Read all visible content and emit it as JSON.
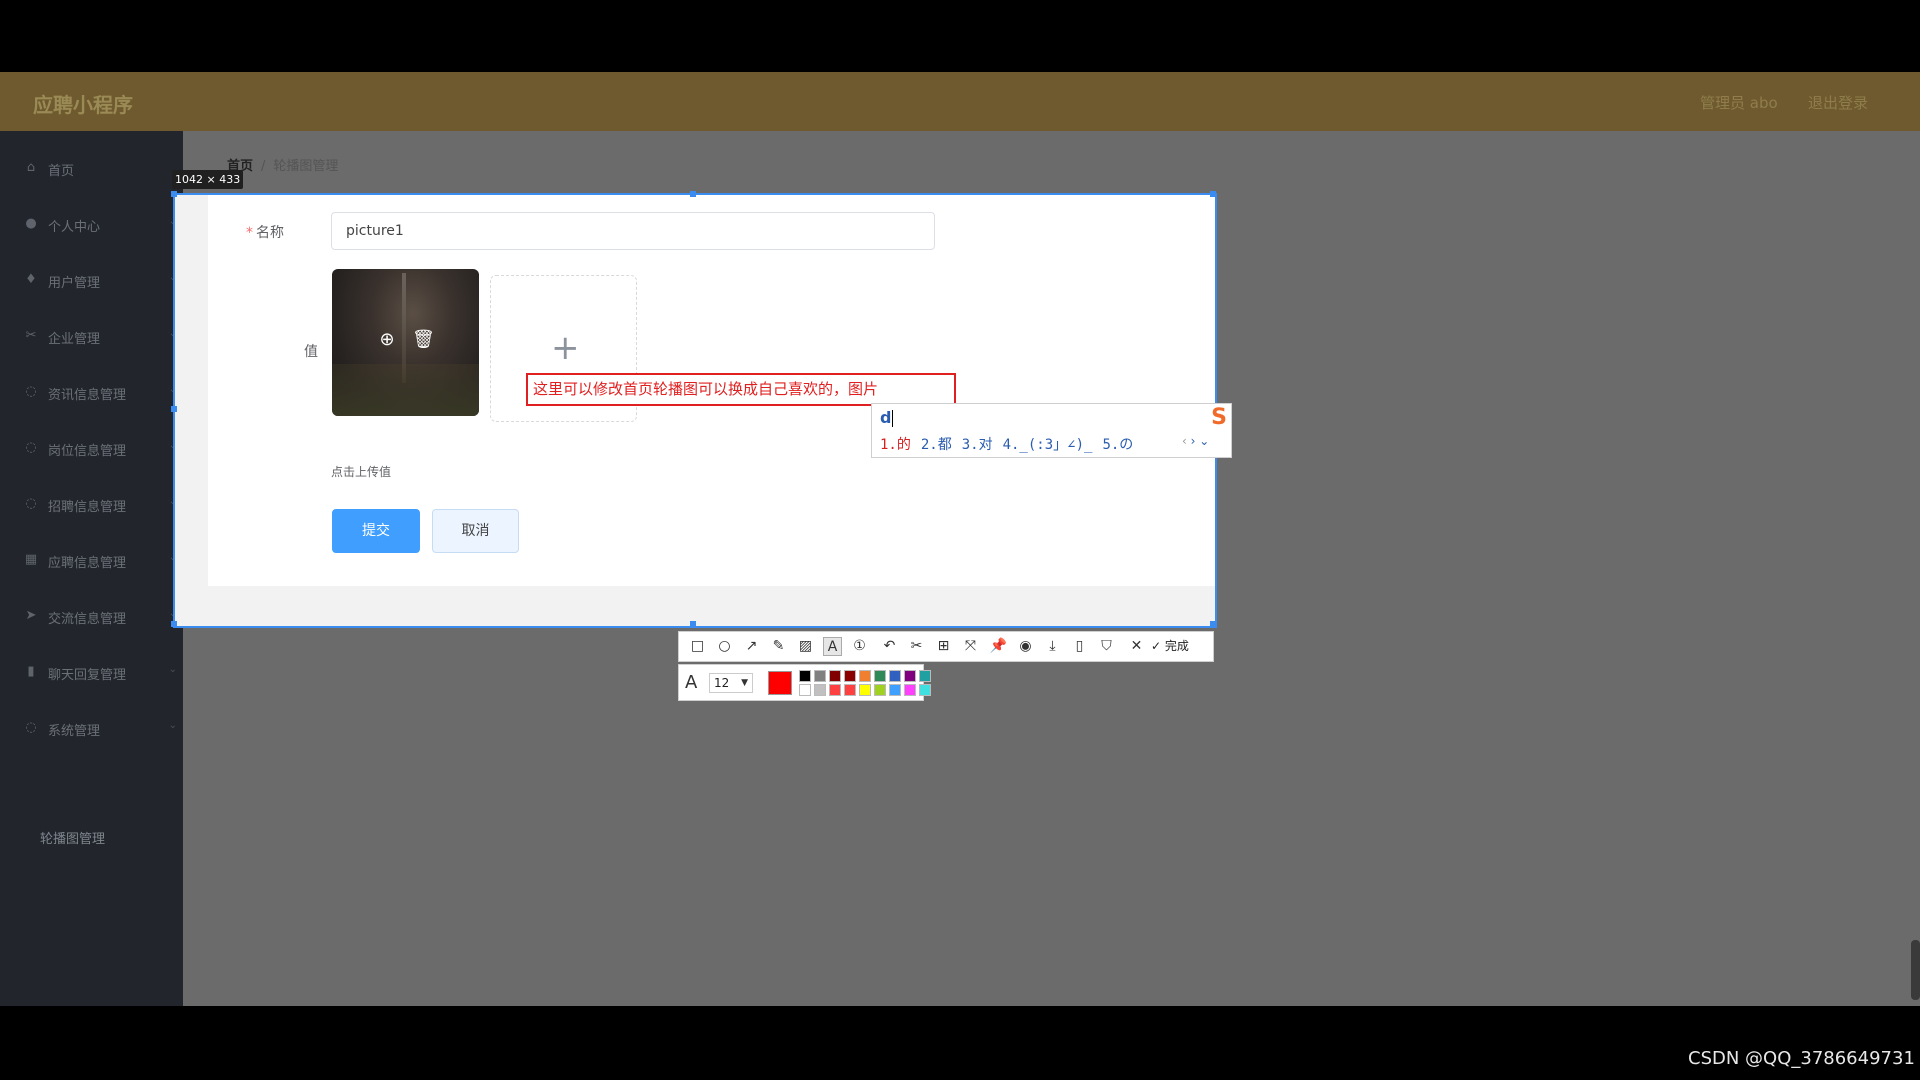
{
  "app": {
    "title": "应聘小程序",
    "admin_info": "管理员 abo",
    "logout": "退出登录"
  },
  "sidebar": {
    "items": [
      {
        "label": "首页",
        "icon": "home-icon",
        "glyph": "⌂"
      },
      {
        "label": "个人中心",
        "icon": "user-icon",
        "glyph": "●"
      },
      {
        "label": "用户管理",
        "icon": "mic-icon",
        "glyph": "♦"
      },
      {
        "label": "企业管理",
        "icon": "scissors-icon",
        "glyph": "✂"
      },
      {
        "label": "资讯信息管理",
        "icon": "circle-icon",
        "glyph": "◌"
      },
      {
        "label": "岗位信息管理",
        "icon": "circle-icon",
        "glyph": "◌"
      },
      {
        "label": "招聘信息管理",
        "icon": "circle-icon",
        "glyph": "◌"
      },
      {
        "label": "应聘信息管理",
        "icon": "bank-icon",
        "glyph": "▦"
      },
      {
        "label": "交流信息管理",
        "icon": "send-icon",
        "glyph": "➤"
      },
      {
        "label": "聊天回复管理",
        "icon": "chart-icon",
        "glyph": "▮"
      },
      {
        "label": "系统管理",
        "icon": "circle-icon",
        "glyph": "◌"
      }
    ],
    "sub_item": "轮播图管理"
  },
  "breadcrumb": {
    "home": "首页",
    "separator": "/",
    "current": "轮播图管理"
  },
  "selection": {
    "size_label": "1042 × 433",
    "border_color": "#3b8cf0"
  },
  "form": {
    "name_label": "名称",
    "name_value": "picture1",
    "value_label": "值",
    "upload_hint": "点击上传值",
    "submit_label": "提交",
    "cancel_label": "取消",
    "annotation_text": "这里可以修改首页轮播图可以换成自己喜欢的，图片",
    "annotation_color": "#e02020"
  },
  "ime": {
    "input": "d",
    "candidates": [
      "1.的",
      "2.都",
      "3.对",
      "4._(:3」∠)_",
      "5.の"
    ],
    "logo_glyph": "S"
  },
  "toolbar": {
    "tools": [
      {
        "name": "rectangle-tool-icon",
        "glyph": "□"
      },
      {
        "name": "ellipse-tool-icon",
        "glyph": "○"
      },
      {
        "name": "arrow-tool-icon",
        "glyph": "↗"
      },
      {
        "name": "pen-tool-icon",
        "glyph": "✎"
      },
      {
        "name": "mosaic-tool-icon",
        "glyph": "▨"
      },
      {
        "name": "text-tool-icon",
        "glyph": "A"
      },
      {
        "name": "number-tool-icon",
        "glyph": "①"
      },
      {
        "name": "undo-icon",
        "glyph": "↶"
      },
      {
        "name": "translate-icon",
        "glyph": "✂"
      },
      {
        "name": "ocr-icon",
        "glyph": "⊞"
      },
      {
        "name": "long-screenshot-icon",
        "glyph": "⤧"
      },
      {
        "name": "pin-icon",
        "glyph": "📌"
      },
      {
        "name": "record-icon",
        "glyph": "◉"
      },
      {
        "name": "download-icon",
        "glyph": "⤓"
      },
      {
        "name": "save-icon",
        "glyph": "▯"
      },
      {
        "name": "bookmark-icon",
        "glyph": "⛉"
      },
      {
        "name": "close-icon",
        "glyph": "✕"
      }
    ],
    "done_label": "完成",
    "done_glyph": "✓",
    "font_glyph": "A",
    "font_size": "12",
    "current_color": "#ff0000",
    "palette": [
      "#000000",
      "#808080",
      "#800000",
      "#8b0000",
      "#f08030",
      "#2e8b57",
      "#3060c0",
      "#800080",
      "#20a0a0",
      "#ffffff",
      "#c0c0c0",
      "#ff4040",
      "#ff4040",
      "#ffff00",
      "#a0d020",
      "#40a0ff",
      "#ff40ff",
      "#40e0e0"
    ]
  },
  "watermark": "CSDN @QQ_3786649731"
}
